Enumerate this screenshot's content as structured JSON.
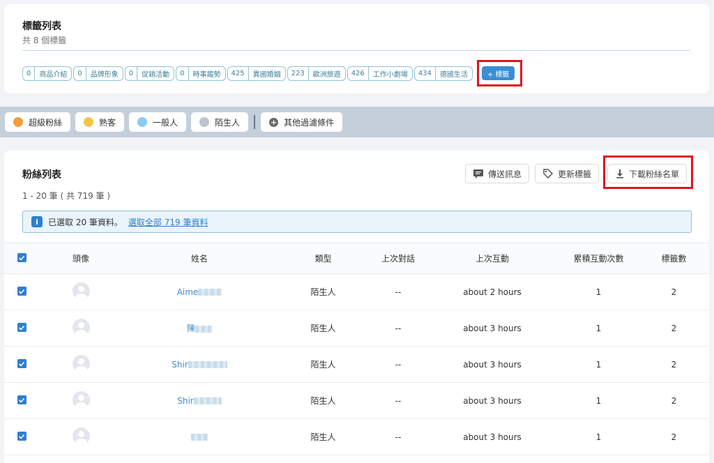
{
  "tags": {
    "title": "標籤列表",
    "subtitle": "共 8 個標籤",
    "add_label": "+ 標籤",
    "items": [
      {
        "count": "0",
        "name": "商品介紹"
      },
      {
        "count": "0",
        "name": "品牌形象"
      },
      {
        "count": "0",
        "name": "促銷活動"
      },
      {
        "count": "0",
        "name": "時事趨勢"
      },
      {
        "count": "425",
        "name": "異國婚姻"
      },
      {
        "count": "223",
        "name": "歐洲旅遊"
      },
      {
        "count": "426",
        "name": "工作小劇場"
      },
      {
        "count": "434",
        "name": "德國生活"
      }
    ]
  },
  "filters": {
    "chips": [
      {
        "label": "超級粉絲",
        "color": "#f39c41"
      },
      {
        "label": "熟客",
        "color": "#f5c54a"
      },
      {
        "label": "一般人",
        "color": "#8ec9f2"
      },
      {
        "label": "陌生人",
        "color": "#bcc4ce"
      }
    ],
    "other_label": "其他過濾條件"
  },
  "fans": {
    "title": "粉絲列表",
    "count_text": "1 - 20 筆 ( 共 719 筆 )",
    "send_message": "傳送訊息",
    "update_tags": "更新標籤",
    "download_list": "下載粉絲名單",
    "alert_text": "已選取 20 筆資料。",
    "alert_link": "選取全部 719 筆資料",
    "columns": [
      "頭像",
      "姓名",
      "類型",
      "上次對話",
      "上次互動",
      "累積互動次數",
      "標籤數"
    ],
    "rows": [
      {
        "name": "Aime",
        "type": "陌生人",
        "last_chat": "--",
        "last_interaction": "about 2 hours",
        "interactions": "1",
        "tags": "2"
      },
      {
        "name": "陳",
        "type": "陌生人",
        "last_chat": "--",
        "last_interaction": "about 3 hours",
        "interactions": "1",
        "tags": "2"
      },
      {
        "name": "Shir",
        "type": "陌生人",
        "last_chat": "--",
        "last_interaction": "about 3 hours",
        "interactions": "1",
        "tags": "2"
      },
      {
        "name": "Shir",
        "type": "陌生人",
        "last_chat": "--",
        "last_interaction": "about 3 hours",
        "interactions": "1",
        "tags": "2"
      },
      {
        "name": "",
        "type": "陌生人",
        "last_chat": "--",
        "last_interaction": "about 3 hours",
        "interactions": "1",
        "tags": "2"
      }
    ]
  }
}
